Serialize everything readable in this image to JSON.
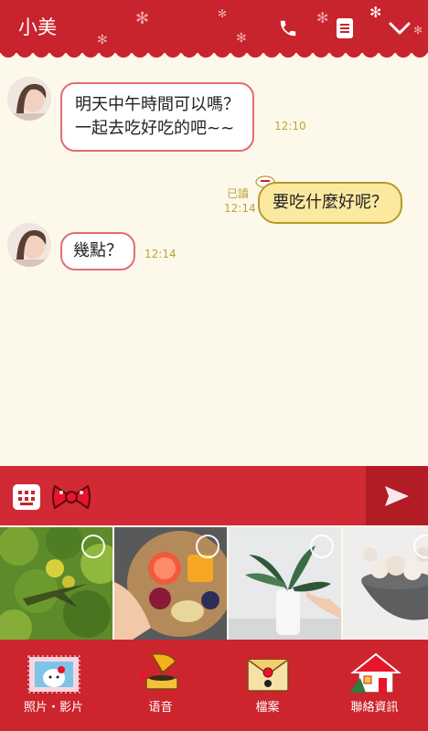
{
  "header": {
    "title": "小美"
  },
  "messages": [
    {
      "side": "left",
      "lines": [
        "明天中午時間可以嗎？",
        "一起去吃好吃的吧~~"
      ],
      "time": "12:10"
    },
    {
      "side": "right",
      "text": "要吃什麼好呢？",
      "read": "已讀",
      "time": "12:14"
    },
    {
      "side": "left",
      "text": "幾點？",
      "time": "12:14"
    }
  ],
  "nav": [
    {
      "label": "照片・影片",
      "icon": "photo-frame-icon"
    },
    {
      "label": "语音",
      "icon": "gramophone-icon"
    },
    {
      "label": "檔案",
      "icon": "envelope-icon"
    },
    {
      "label": "聯絡資訊",
      "icon": "house-icon"
    }
  ],
  "colors": {
    "header": "#c8242d",
    "background": "#fdf9ea",
    "accent_time": "#bba33a",
    "own_bubble": "#fbe9a0"
  }
}
